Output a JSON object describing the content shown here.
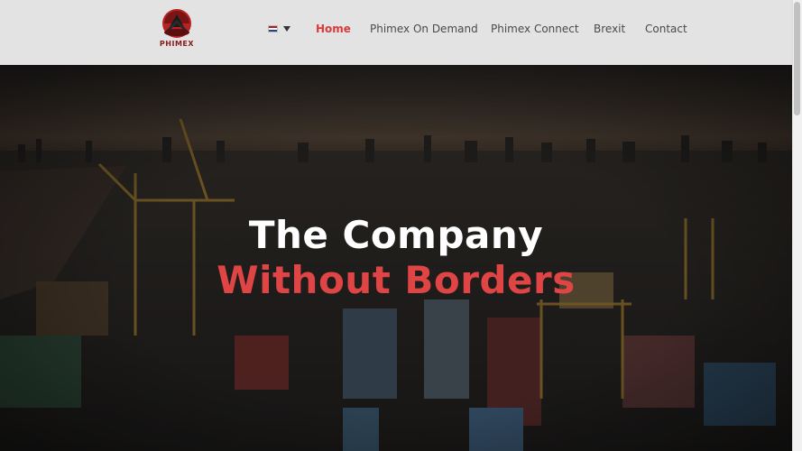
{
  "header": {
    "logo_text": "PHIMEX",
    "language_flag": "netherlands-flag-icon",
    "nav": [
      {
        "label": "Home",
        "active": true
      },
      {
        "label": "Phimex On Demand",
        "active": false
      },
      {
        "label": "Phimex Connect",
        "active": false
      },
      {
        "label": "Brexit",
        "active": false
      },
      {
        "label": "Contact",
        "active": false
      }
    ]
  },
  "hero": {
    "headline_line1": "The Company",
    "headline_line2": "Without Borders",
    "background": "aerial-container-port-city-skyline"
  },
  "colors": {
    "accent": "#d93a3a",
    "header_bg": "#e3e3e3",
    "nav_text": "#4a4a4a",
    "headline_white": "#ffffff",
    "headline_red": "#e04545"
  }
}
